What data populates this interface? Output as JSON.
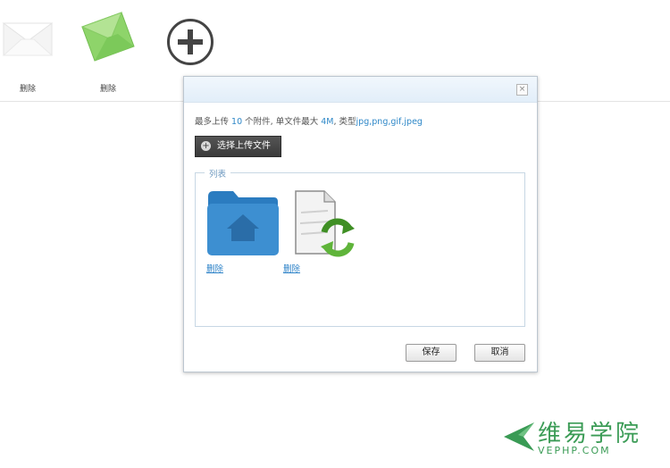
{
  "thumbnails": [
    {
      "delete_label": "删除",
      "icon": "envelope-white-icon"
    },
    {
      "delete_label": "删除",
      "icon": "envelope-green-icon"
    }
  ],
  "add_button": {
    "icon": "plus-circle-icon"
  },
  "dialog": {
    "close_label": "×",
    "hint": {
      "prefix": "最多上传",
      "count": "10",
      "mid": "个附件, 单文件最大",
      "size": "4M",
      "types_prefix": ", 类型",
      "types": "jpg,png,gif,jpeg"
    },
    "select_button_label": "选择上传文件",
    "list": {
      "legend": "列表",
      "items": [
        {
          "delete_label": "删除",
          "icon": "folder-home-icon"
        },
        {
          "delete_label": "删除",
          "icon": "file-refresh-icon"
        }
      ]
    },
    "save_label": "保存",
    "cancel_label": "取消"
  },
  "brand": {
    "name": "维易学院",
    "domain": "VEPHP.COM"
  },
  "colors": {
    "accent": "#2f88c8",
    "brand": "#3a9b55",
    "folder": "#3d8fd1"
  }
}
